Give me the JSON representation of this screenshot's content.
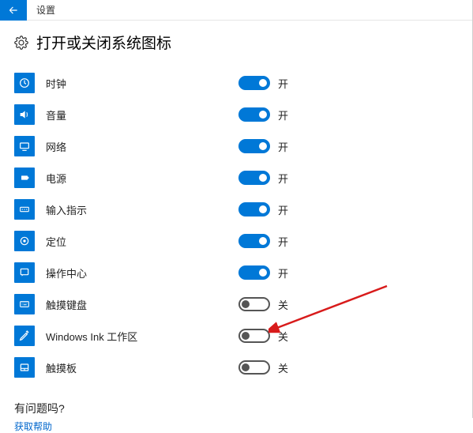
{
  "titlebar": {
    "title": "设置"
  },
  "page": {
    "title": "打开或关闭系统图标"
  },
  "state_labels": {
    "on": "开",
    "off": "关"
  },
  "items": [
    {
      "label": "时钟",
      "on": true,
      "icon": "clock"
    },
    {
      "label": "音量",
      "on": true,
      "icon": "volume"
    },
    {
      "label": "网络",
      "on": true,
      "icon": "network"
    },
    {
      "label": "电源",
      "on": true,
      "icon": "power"
    },
    {
      "label": "输入指示",
      "on": true,
      "icon": "input"
    },
    {
      "label": "定位",
      "on": true,
      "icon": "location"
    },
    {
      "label": "操作中心",
      "on": true,
      "icon": "action-center"
    },
    {
      "label": "触摸键盘",
      "on": false,
      "icon": "touch-keyboard"
    },
    {
      "label": "Windows Ink 工作区",
      "on": false,
      "icon": "ink"
    },
    {
      "label": "触摸板",
      "on": false,
      "icon": "touchpad"
    }
  ],
  "footer": {
    "question": "有问题吗?",
    "help": "获取帮助"
  }
}
